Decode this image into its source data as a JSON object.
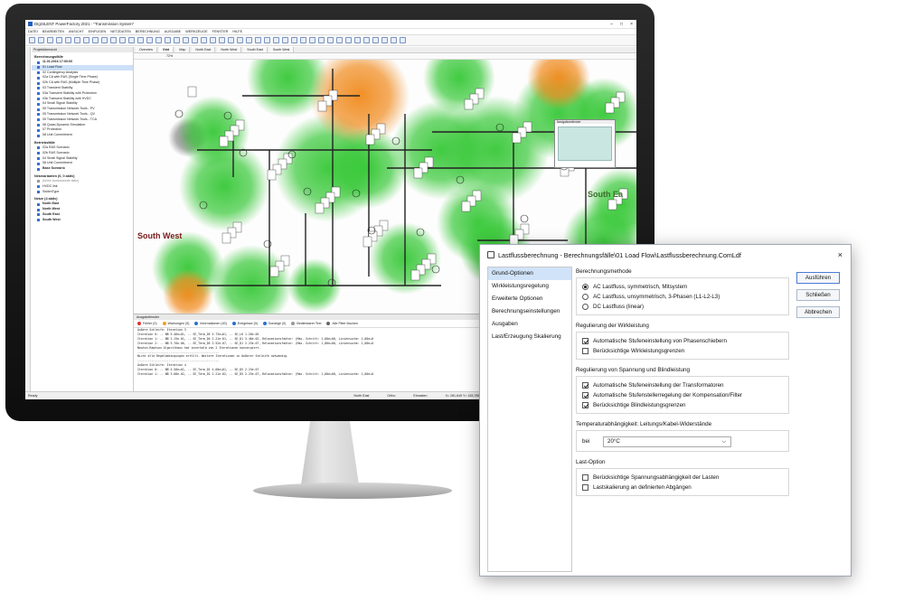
{
  "app": {
    "title": "DIgSILENT PowerFactory 2021 - \"Transmission System\"",
    "window_controls": [
      "–",
      "□",
      "×"
    ],
    "menu": [
      "DATEI",
      "BEARBEITEN",
      "ANSICHT",
      "EINFÜGEN",
      "NETZDATEN",
      "BERECHNUNG",
      "AUSGABE",
      "WERKZEUGE",
      "FENSTER",
      "HILFE"
    ]
  },
  "sidebar": {
    "header": "Projektübersicht",
    "vertical_tabs": [
      "Projektübersicht",
      "Zeichenwerkzeuge"
    ],
    "groups": [
      {
        "title": "Berechnungsfälle",
        "items": [
          {
            "label": "11.01.2016 17:00:00",
            "style": "b"
          },
          {
            "label": "01 Load Flow",
            "style": "sel"
          },
          {
            "label": "02 Contingency Analysis"
          },
          {
            "label": "02a CA with RAS (Single Time Phase)"
          },
          {
            "label": "02b CA with RAS (Multiple Time Phase)"
          },
          {
            "label": "03 Transient Stability"
          },
          {
            "label": "03a Transient Stability with Protection"
          },
          {
            "label": "03b Transient Stability with HVDC"
          },
          {
            "label": "04 Small Signal Stability"
          },
          {
            "label": "05 Transmission Network Tools - PV"
          },
          {
            "label": "05 Transmission Network Tools - QV"
          },
          {
            "label": "05 Transmission Network Tools - TCA"
          },
          {
            "label": "06 Quasi-Dynamic Simulation"
          },
          {
            "label": "07 Protection"
          },
          {
            "label": "08 Unit Commitment"
          }
        ]
      },
      {
        "title": "Betriebsfälle",
        "items": [
          {
            "label": "02a RAS Scenario"
          },
          {
            "label": "02b RAS Scenario"
          },
          {
            "label": "04 Small Signal Stability"
          },
          {
            "label": "08 Unit Commitment"
          },
          {
            "label": "Base Scenario",
            "style": "b"
          }
        ]
      },
      {
        "title": "Netzvarianten (0, 0 aktiv)",
        "items": [
          {
            "label": "(keine Ausbaustufe aktiv)",
            "style": "grey"
          },
          {
            "label": "HVDC link"
          },
          {
            "label": "SwitchType"
          }
        ]
      },
      {
        "title": "Netze (4 aktiv)",
        "items": [
          {
            "label": "North East",
            "style": "b"
          },
          {
            "label": "North West",
            "style": "b"
          },
          {
            "label": "South East",
            "style": "b"
          },
          {
            "label": "South West",
            "style": "b"
          }
        ]
      }
    ]
  },
  "diagram": {
    "tabs": [
      "Overview",
      "Grid",
      "Map",
      "North East",
      "North West",
      "South East",
      "South West"
    ],
    "active_tab": "Grid",
    "zoom": "72%",
    "zone_labels": {
      "south_west": "South West",
      "south_east": "South Ea"
    },
    "nav_window": "Navigationsfenster"
  },
  "output": {
    "header": "Ausgabefenster",
    "filters": [
      "Fehler (0)",
      "Warnungen (5)",
      "Informationen (40)",
      "Ereignisse (0)",
      "Sonstige (0)",
      "Bedienbarer Text",
      "Alle Filter löschen"
    ],
    "lines": [
      "Äußere Schleife: Iteration 3",
      "Iteration  0:  -- NB        5.46e+01,  -- SE_Term_D5  5.73e+01,  -- SE_L6  1.26e-05",
      "Iteration  1:  -- NB        2.15e-01,  -- SE_Term_D4  2.21e-01,  -- SE_D1  3.40e-02, Relaxationsfaktor: (Max. Schritt: 1,00e+00, Liniensuche: 1,00e+0",
      "Iteration  2:  -- NB        5.76e-06,  -- SE_Term_D5  2.52e-07,  -- SE_D1  2.23e-07, Relaxationsfaktor: (Max. Schritt: 1,00e+00, Liniensuche: 1,00e+0",
      "Newton-Raphson Algorithmus hat innerhalb von 2 Iterationen konvergiert.",
      "-----------------------------------------------",
      "Nicht alle Regelbedingungen erfüllt. Weitere Iterationen in äußerer Schleife notwendig.",
      "-----------------------------------------------",
      "Äußere Schleife: Iteration 4",
      "Iteration  0:  -- NB        4.58e+01,  -- SE_Term_D1  4.60e+01,  -- SE_D5  2.23e-07",
      "Iteration  1:  -- NB        3.08e-02,  -- SE_Term_D1  1.21e-02,  -- SE_D5  2.23e-07, Relaxationsfaktor: (Max. Schritt: 1,00e+00, Liniensuche: 1,00e+0"
    ]
  },
  "status": {
    "left": "Ready",
    "fields": [
      "North East",
      "Ortho",
      "Einrasten",
      "X= 281,645 Y= 183,786"
    ]
  },
  "dialog": {
    "title": "Lastflussberechnung - Berechnungsfälle\\01 Load Flow\\Lastflussberechnung.ComLdf",
    "close": "×",
    "nav": [
      "Grund-Optionen",
      "Wirkleistungsregelung",
      "Erweiterte Optionen",
      "Berechnungseinstellungen",
      "Ausgaben",
      "Last/Erzeugung Skalierung"
    ],
    "nav_selected": 0,
    "method": {
      "title": "Berechnungsmethode",
      "options": [
        "AC Lastfluss, symmetrisch, Mitsystem",
        "AC Lastfluss, unsymmetrisch, 3-Phasen (L1-L2-L3)",
        "DC Lastfluss (linear)"
      ],
      "selected": 0
    },
    "active_power": {
      "title": "Regulierung der Wirkleistung",
      "checks": [
        {
          "label": "Automatische Stufeneinstellung von Phasenschiebern",
          "checked": true
        },
        {
          "label": "Berücksichtige Wirkleistungsgrenzen",
          "checked": false
        }
      ]
    },
    "voltage": {
      "title": "Regulierung von Spannung und Blindleistung",
      "checks": [
        {
          "label": "Automatische Stufeneinstellung der Transformatoren",
          "checked": true
        },
        {
          "label": "Automatische Stufenstellerregelung der Kompensation/Filter",
          "checked": true
        },
        {
          "label": "Berücksichtige Blindleistungsgrenzen",
          "checked": true
        }
      ]
    },
    "temperature": {
      "title": "Temperaturabhängigkeit: Leitungs/Kabel-Widerstände",
      "label": "bei",
      "value": "20°C"
    },
    "load": {
      "title": "Last-Option",
      "checks": [
        {
          "label": "Berücksichtige Spannungsabhängigkeit der Lasten",
          "checked": false
        },
        {
          "label": "Lastskalierung an definierten Abgängen",
          "checked": false
        }
      ]
    },
    "buttons": [
      "Ausführen",
      "Schließen",
      "Abbrechen"
    ]
  }
}
